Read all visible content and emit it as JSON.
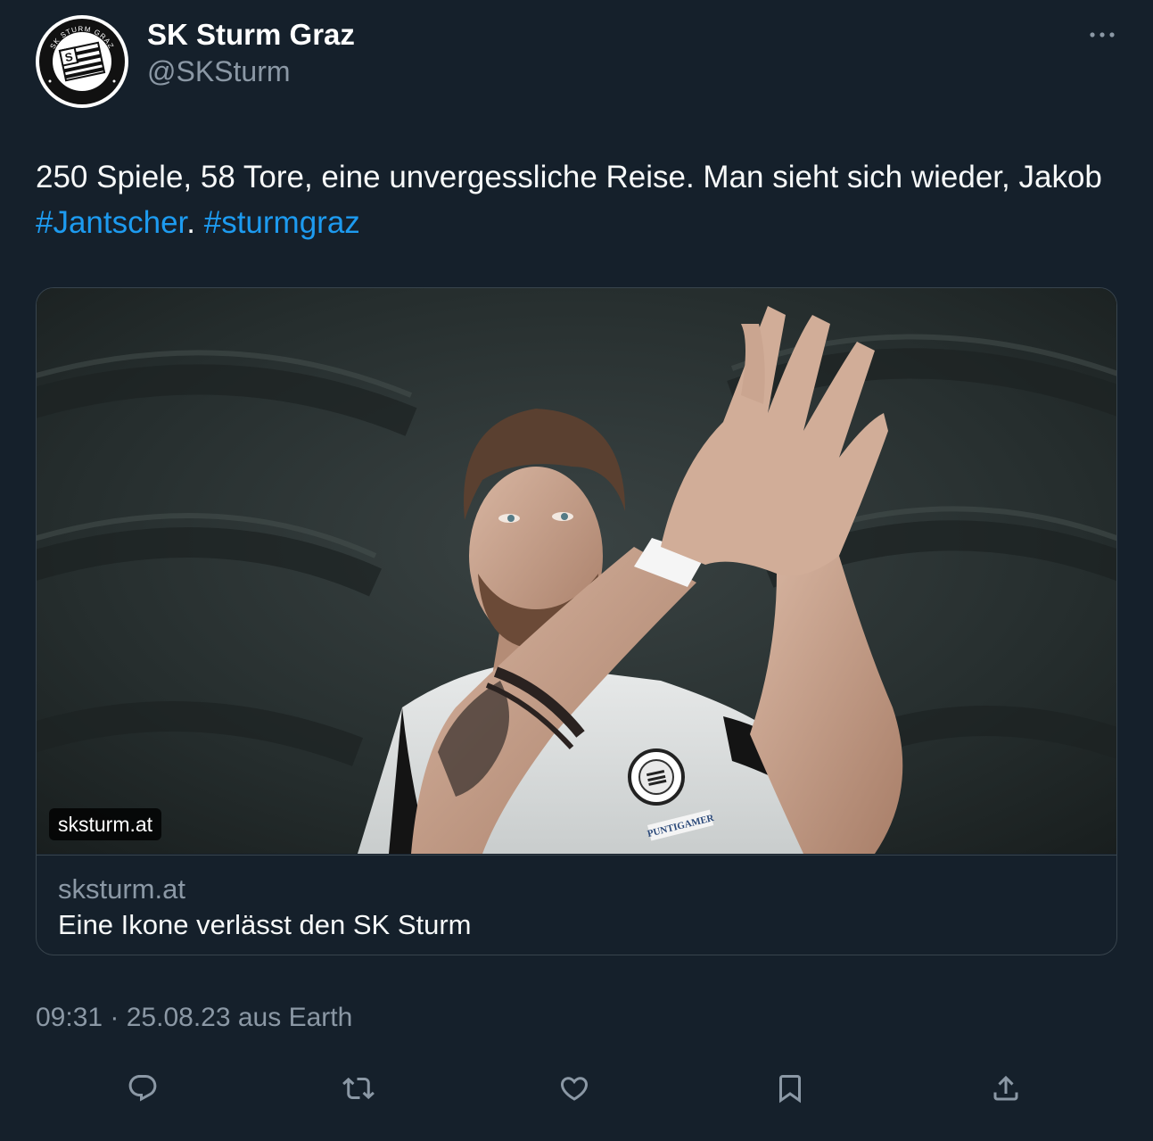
{
  "author": {
    "name": "SK Sturm Graz",
    "handle": "@SKSturm",
    "avatar_ring_text": "SK STURM GRAZ",
    "avatar_bottom_text": "SEIT 1909"
  },
  "tweet": {
    "text_part1": "250 Spiele, 58 Tore, eine unvergessliche Reise. Man sieht sich wieder, Jakob ",
    "hashtag1": "#Jantscher",
    "text_part2": ". ",
    "hashtag2": "#sturmgraz"
  },
  "card": {
    "image_badge": "sksturm.at",
    "domain": "sksturm.at",
    "title": "Eine Ikone verlässt den SK Sturm",
    "jersey_sponsor": "PUNTIGAMER"
  },
  "meta": {
    "time": "09:31",
    "separator": " · ",
    "date": "25.08.23",
    "source": " aus Earth"
  },
  "actions": [
    {
      "icon": "reply-icon"
    },
    {
      "icon": "retweet-icon"
    },
    {
      "icon": "like-icon"
    },
    {
      "icon": "bookmark-icon"
    },
    {
      "icon": "share-icon"
    }
  ],
  "colors": {
    "background": "#15202b",
    "text": "#f7f9f9",
    "secondary": "#8b98a5",
    "link": "#1d9bf0",
    "border": "#38444d"
  }
}
